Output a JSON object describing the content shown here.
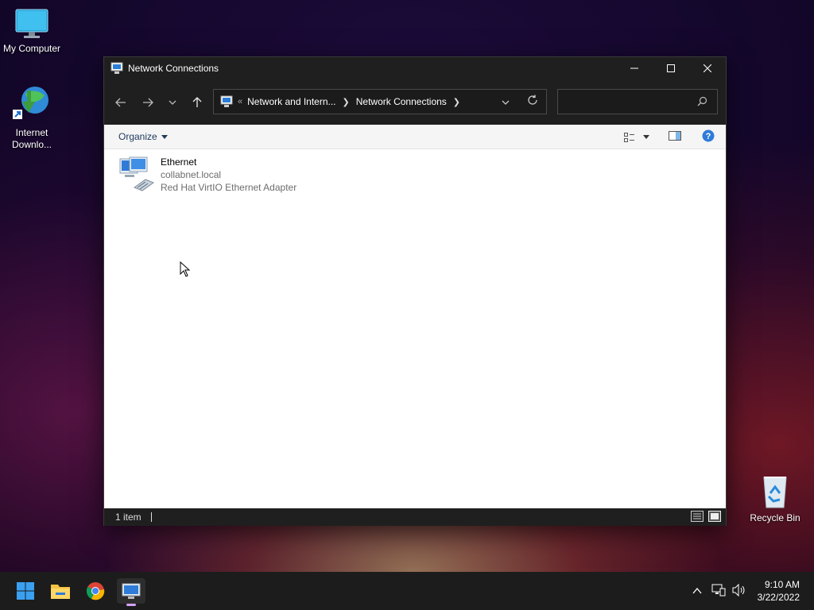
{
  "desktop": {
    "icons": [
      {
        "label": "My Computer"
      },
      {
        "label": "Internet Downlo..."
      },
      {
        "label": "Recycle Bin"
      }
    ]
  },
  "window": {
    "title": "Network Connections",
    "address": {
      "overflow": "«",
      "crumbs": [
        "Network and Intern...",
        "Network Connections"
      ]
    },
    "search": {
      "value": "",
      "placeholder": ""
    },
    "toolbar": {
      "organize_label": "Organize"
    },
    "items": [
      {
        "name": "Ethernet",
        "network": "collabnet.local",
        "adapter": "Red Hat VirtIO Ethernet Adapter",
        "icon": "network-adapter-icon"
      }
    ],
    "status": {
      "item_count": "1 item"
    }
  },
  "taskbar": {
    "apps": [
      "start-icon",
      "file-explorer-icon",
      "chrome-icon",
      "network-connections-icon"
    ],
    "clock": {
      "time": "9:10 AM",
      "date": "3/22/2022"
    }
  },
  "colors": {
    "accent": "#0078d4",
    "titlebar": "#1f1f1f",
    "organize_text": "#1e395b",
    "help": "#2f7bd8"
  }
}
